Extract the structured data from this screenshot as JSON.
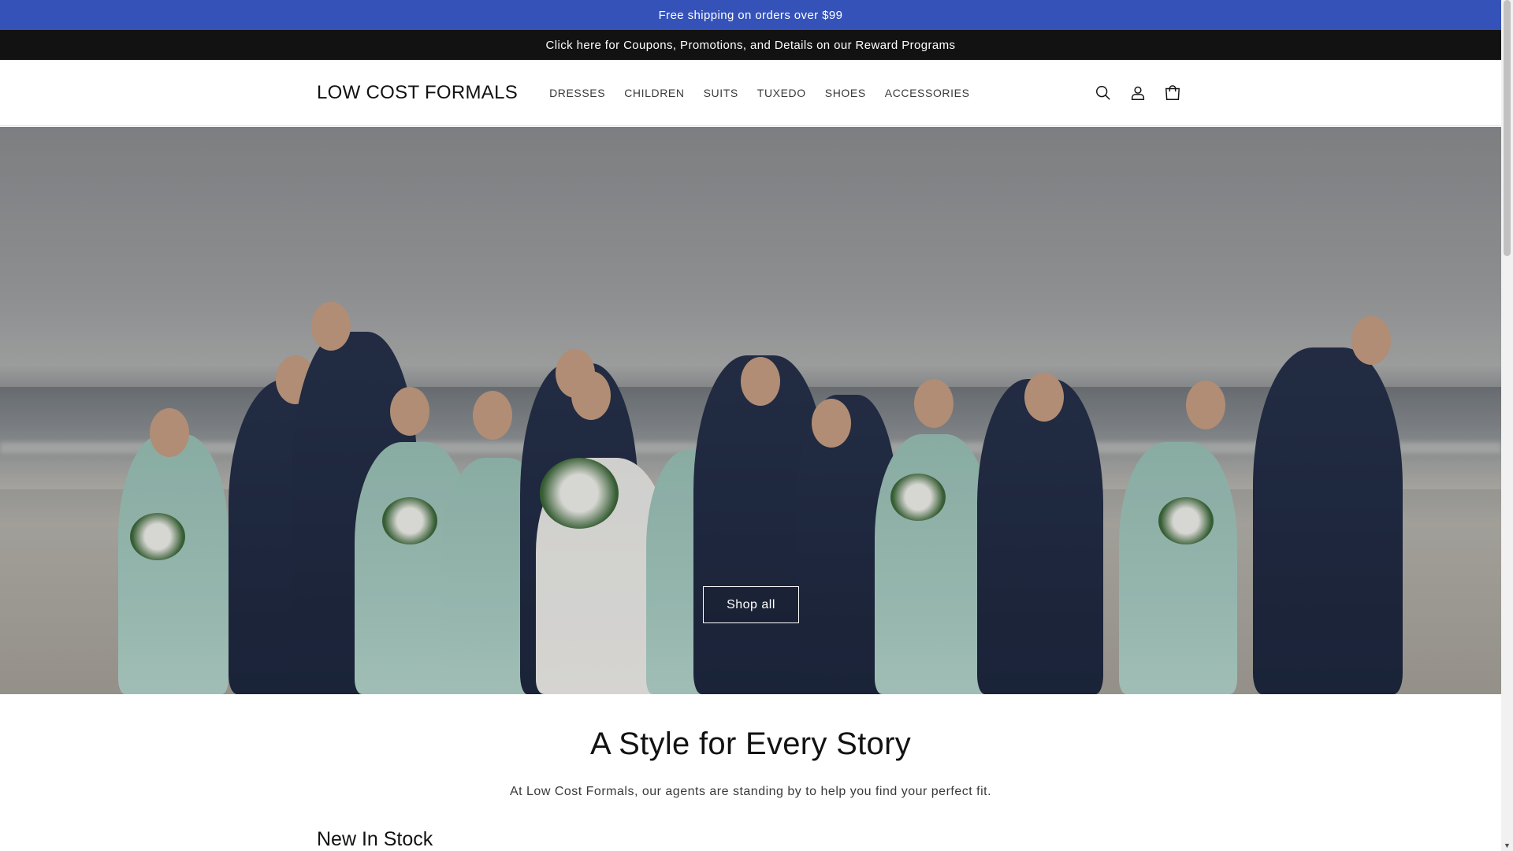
{
  "announcements": {
    "shipping": "Free shipping on orders over $99",
    "coupons": "Click here for Coupons, Promotions, and Details on our Reward Programs"
  },
  "header": {
    "logo": "LOW COST FORMALS",
    "nav": [
      "DRESSES",
      "CHILDREN",
      "SUITS",
      "TUXEDO",
      "SHOES",
      "ACCESSORIES"
    ],
    "icons": [
      "search-icon",
      "account-icon",
      "cart-icon"
    ]
  },
  "hero": {
    "button_label": "Shop all"
  },
  "intro": {
    "title": "A Style for Every Story",
    "subtitle": "At Low Cost Formals, our agents are standing by to help you find your perfect fit."
  },
  "collection": {
    "title": "New In Stock"
  },
  "colors": {
    "announcement_bar": "#3452b8",
    "secondary_bar": "#121212",
    "text": "#121212"
  }
}
